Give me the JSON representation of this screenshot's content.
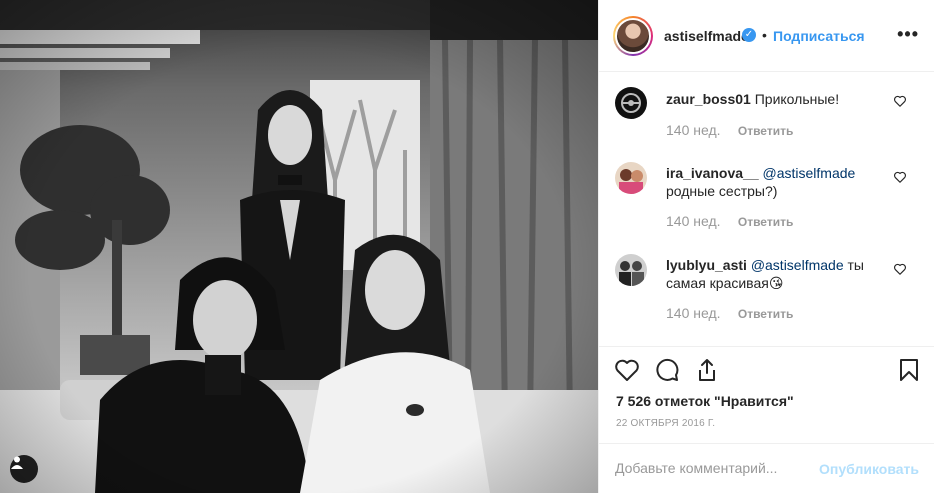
{
  "post": {
    "username": "astiselfmade",
    "verified_mark": "✓",
    "dot": "•",
    "follow_label": "Подписаться",
    "more_label": "•••",
    "photo": {
      "description_icon": "person-tag-icon",
      "tone": "black-and-white group photo of three women"
    }
  },
  "comments": [
    {
      "username": "zaur_boss01",
      "mention": "",
      "text": "Прикольные!",
      "time": "140 нед.",
      "reply_label": "Ответить"
    },
    {
      "username": "ira_ivanova__",
      "mention": "@astiselfmade",
      "text": "родные сестры?)",
      "time": "140 нед.",
      "reply_label": "Ответить"
    },
    {
      "username": "lyublyu_asti",
      "mention": "@astiselfmade",
      "text": "ты самая красивая😘",
      "time": "140 нед.",
      "reply_label": "Ответить"
    }
  ],
  "actions": {
    "like_icon": "heart-icon",
    "comment_icon": "comment-icon",
    "share_icon": "share-icon",
    "save_icon": "bookmark-icon"
  },
  "likes_text": "7 526 отметок \"Нравится\"",
  "date_text": "22 октября 2016 г.",
  "add_comment": {
    "placeholder": "Добавьте комментарий...",
    "publish_label": "Опубликовать"
  },
  "colors": {
    "accent": "#3897f0",
    "text": "#262626",
    "muted": "#999999",
    "border": "#efefef",
    "publish_disabled": "#b2dffc"
  }
}
